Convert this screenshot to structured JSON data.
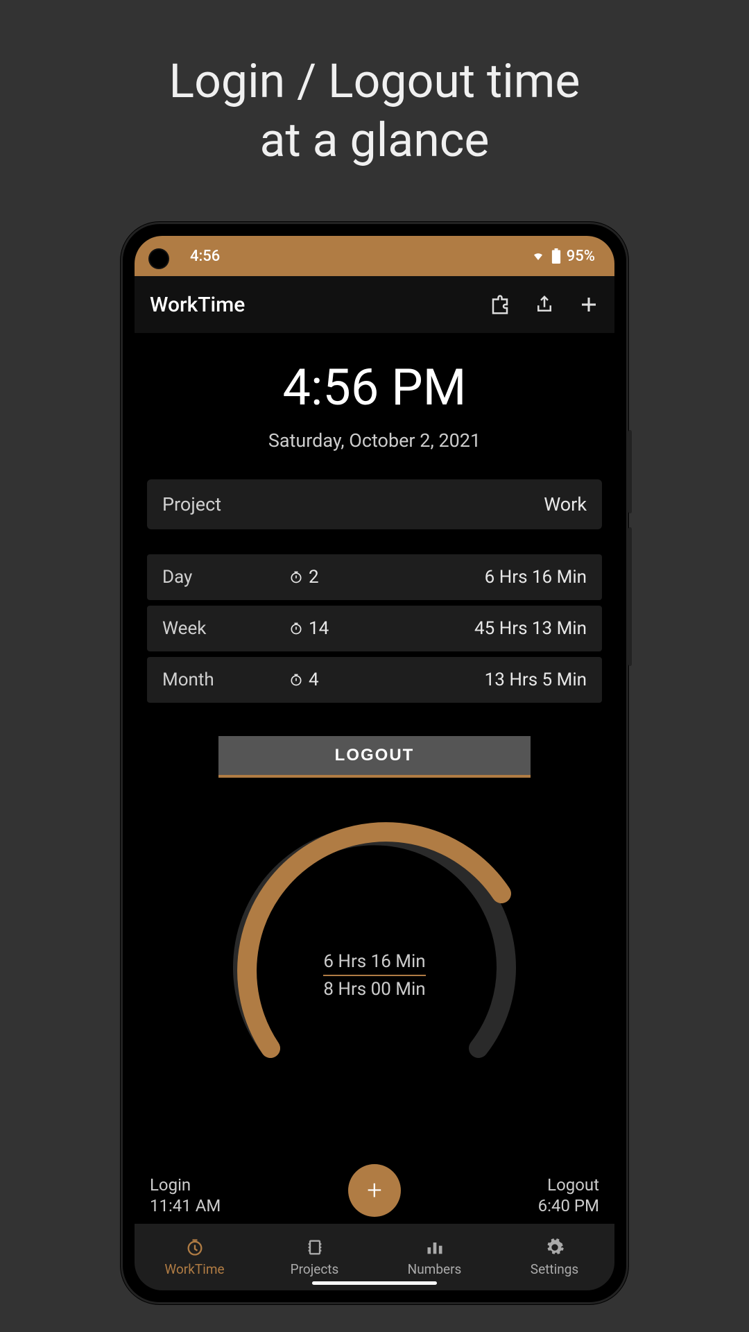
{
  "promo": {
    "line1": "Login / Logout time",
    "line2": "at a glance"
  },
  "statusbar": {
    "time": "4:56",
    "battery": "95%"
  },
  "appbar": {
    "title": "WorkTime"
  },
  "clock": {
    "time": "4:56 PM",
    "date": "Saturday, October 2, 2021"
  },
  "project": {
    "label": "Project",
    "value": "Work"
  },
  "stats": [
    {
      "period": "Day",
      "count": "2",
      "duration": "6 Hrs 16 Min"
    },
    {
      "period": "Week",
      "count": "14",
      "duration": "45 Hrs 13 Min"
    },
    {
      "period": "Month",
      "count": "4",
      "duration": "13 Hrs 5 Min"
    }
  ],
  "logout_button": "LOGOUT",
  "gauge": {
    "elapsed": "6 Hrs 16 Min",
    "total": "8 Hrs 00 Min"
  },
  "login": {
    "label": "Login",
    "time": "11:41 AM"
  },
  "logout": {
    "label": "Logout",
    "time": "6:40 PM"
  },
  "nav": [
    {
      "label": "WorkTime"
    },
    {
      "label": "Projects"
    },
    {
      "label": "Numbers"
    },
    {
      "label": "Settings"
    }
  ],
  "colors": {
    "accent": "#b07c44"
  }
}
